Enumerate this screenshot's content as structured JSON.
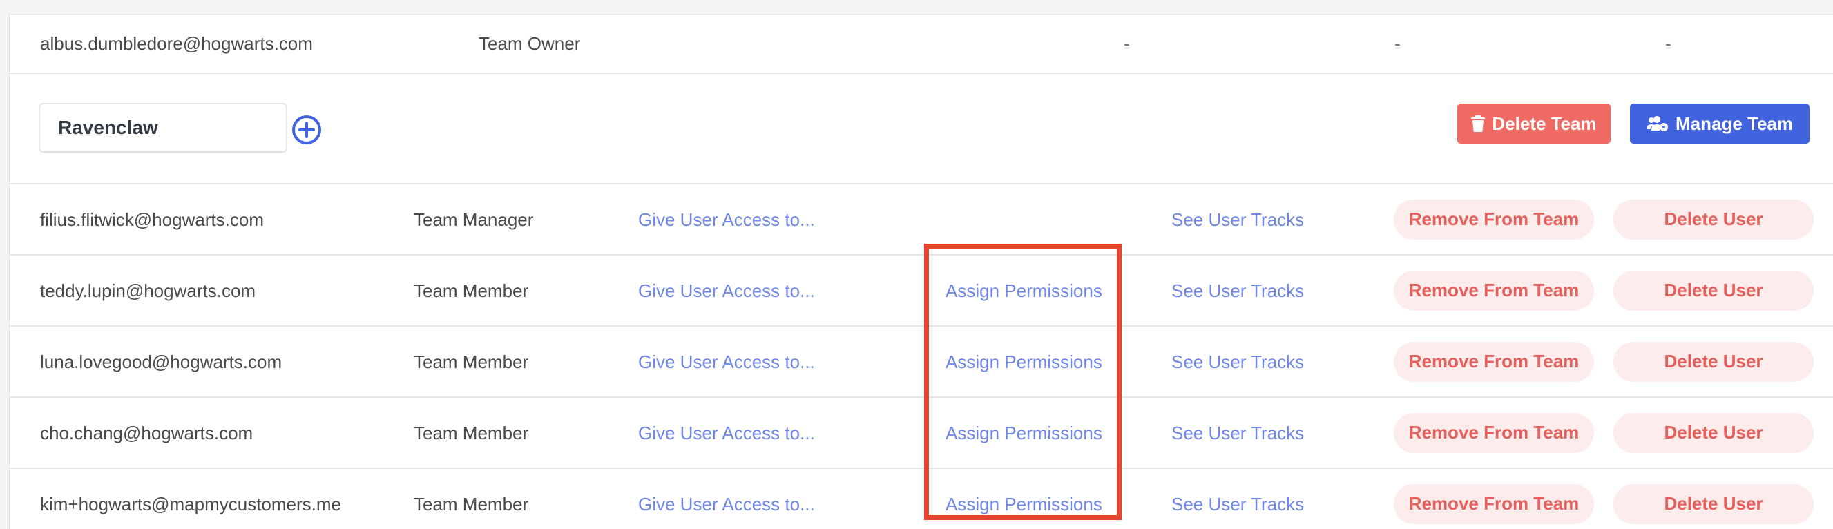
{
  "owner_row": {
    "email": "albus.dumbledore@hogwarts.com",
    "role": "Team Owner",
    "dash1": "-",
    "dash2": "-",
    "dash3": "-"
  },
  "team": {
    "name": "Ravenclaw",
    "delete_label": "Delete Team",
    "manage_label": "Manage Team"
  },
  "members": [
    {
      "email": "filius.flitwick@hogwarts.com",
      "role": "Team Manager",
      "access_link": "Give User Access to...",
      "permissions_link": "",
      "tracks_link": "See User Tracks",
      "remove_label": "Remove From Team",
      "delete_label": "Delete User"
    },
    {
      "email": "teddy.lupin@hogwarts.com",
      "role": "Team Member",
      "access_link": "Give User Access to...",
      "permissions_link": "Assign Permissions",
      "tracks_link": "See User Tracks",
      "remove_label": "Remove From Team",
      "delete_label": "Delete User"
    },
    {
      "email": "luna.lovegood@hogwarts.com",
      "role": "Team Member",
      "access_link": "Give User Access to...",
      "permissions_link": "Assign Permissions",
      "tracks_link": "See User Tracks",
      "remove_label": "Remove From Team",
      "delete_label": "Delete User"
    },
    {
      "email": "cho.chang@hogwarts.com",
      "role": "Team Member",
      "access_link": "Give User Access to...",
      "permissions_link": "Assign Permissions",
      "tracks_link": "See User Tracks",
      "remove_label": "Remove From Team",
      "delete_label": "Delete User"
    },
    {
      "email": "kim+hogwarts@mapmycustomers.me",
      "role": "Team Member",
      "access_link": "Give User Access to...",
      "permissions_link": "Assign Permissions",
      "tracks_link": "See User Tracks",
      "remove_label": "Remove From Team",
      "delete_label": "Delete User"
    }
  ],
  "icons": {
    "add": "plus-circle-icon",
    "trash": "trash-icon",
    "users_cog": "users-cog-icon"
  },
  "colors": {
    "link": "#6f86ea",
    "danger": "#ee6a62",
    "danger_soft": "#fdecec",
    "primary": "#4263e0",
    "highlight": "#e4452c"
  }
}
